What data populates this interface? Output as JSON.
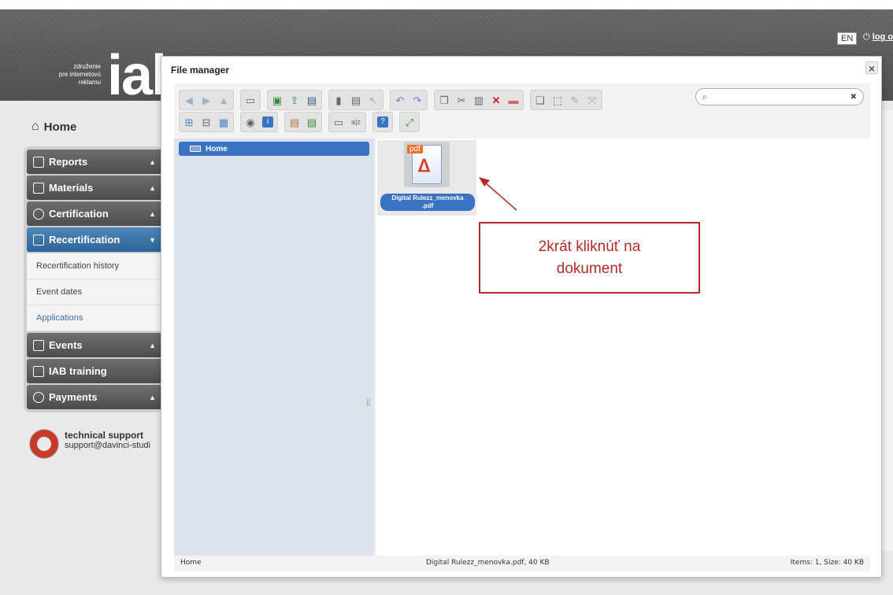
{
  "header": {
    "logo_text": "združenie\npre internetovú\nreklamu",
    "logo_mark": "iab",
    "lang": "EN",
    "logout": "log out"
  },
  "sidebar": {
    "home": "Home",
    "items": [
      {
        "label": "Reports",
        "icon": "chart-icon",
        "caret": "▲"
      },
      {
        "label": "Materials",
        "icon": "folder-icon",
        "caret": "▲"
      },
      {
        "label": "Certification",
        "icon": "badge-icon",
        "caret": "▲"
      },
      {
        "label": "Recertification",
        "icon": "calendar-check-icon",
        "caret": "▼",
        "active": true
      },
      {
        "label": "Events",
        "icon": "calendar-icon",
        "caret": "▲"
      },
      {
        "label": "IAB training",
        "icon": "presentation-icon",
        "caret": ""
      },
      {
        "label": "Payments",
        "icon": "coin-icon",
        "caret": "▲"
      }
    ],
    "submenu": [
      "Recertification history",
      "Event dates",
      "Applications"
    ],
    "support_title": "technical support",
    "support_email": "support@davinci-studi"
  },
  "dialog": {
    "title": "File manager",
    "close": "×",
    "search_value": "",
    "tree_root": "Home",
    "file": {
      "type_tag": "pdf",
      "name": "Digital Rulezz_menovka\n.pdf"
    },
    "status": {
      "path": "Home",
      "selection": "Digital Rulezz_menovka.pdf, 40 KB",
      "summary": "Items: 1, Size: 40 KB"
    }
  },
  "annotation": {
    "text_line1": "2krát kliknúť na",
    "text_line2": "dokument",
    "color": "#b52a2a"
  },
  "colors": {
    "active_menu": "#3a6ea5",
    "selection": "#3a72c4",
    "pdf_tag": "#e8702a"
  }
}
